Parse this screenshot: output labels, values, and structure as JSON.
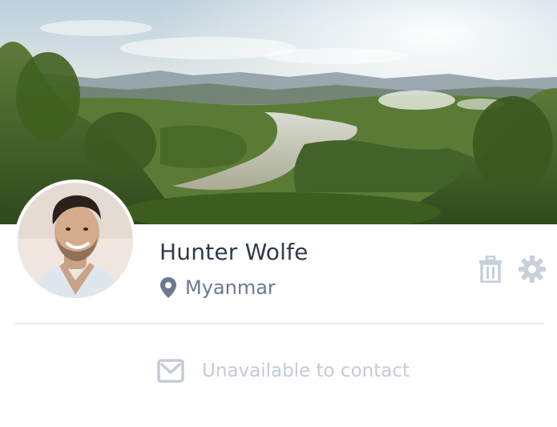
{
  "profile": {
    "name": "Hunter Wolfe",
    "location": "Myanmar"
  },
  "actions": {
    "delete_icon": "trash-icon",
    "settings_icon": "gear-icon"
  },
  "contact": {
    "status": "Unavailable to contact",
    "icon": "mail-icon"
  },
  "colors": {
    "name_text": "#2f3a4b",
    "location_text": "#6b7a8f",
    "action_icon": "#c7d0db",
    "contact_text": "#c3cbd6",
    "divider": "#e8ecf1"
  }
}
